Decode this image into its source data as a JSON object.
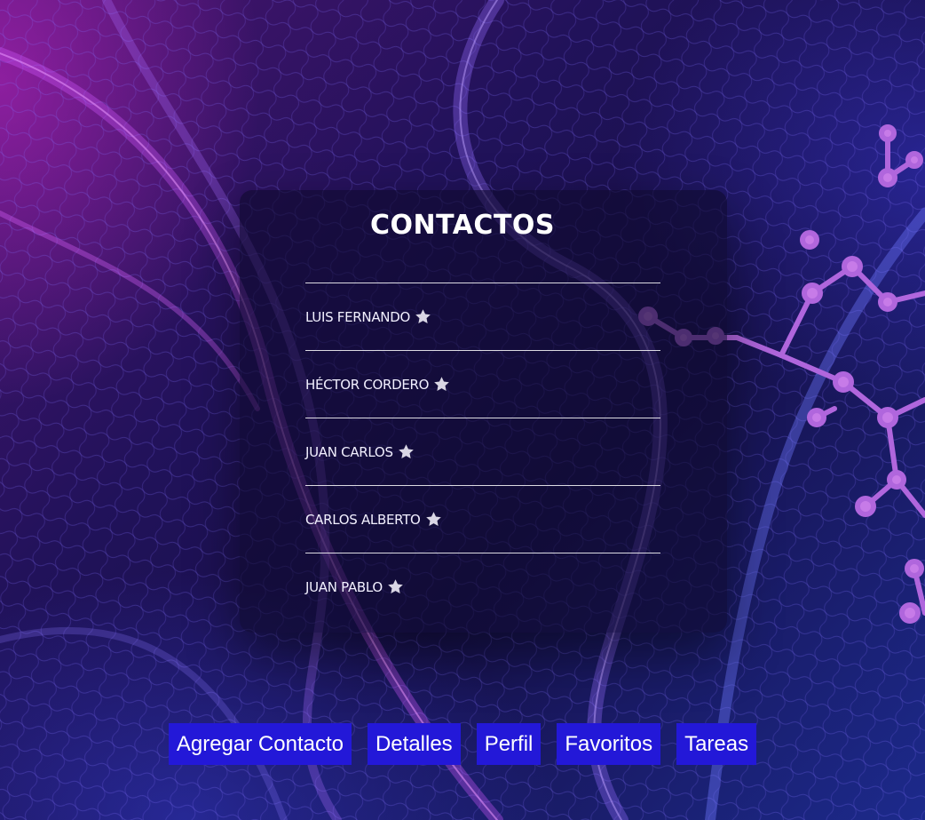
{
  "contacts": {
    "title": "CONTACTOS",
    "items": [
      {
        "name": "LUIS FERNANDO"
      },
      {
        "name": "HÉCTOR CORDERO"
      },
      {
        "name": "JUAN CARLOS"
      },
      {
        "name": "CARLOS ALBERTO"
      },
      {
        "name": "JUAN PABLO"
      }
    ],
    "favorite_icon": "star-icon"
  },
  "nav": {
    "buttons": [
      {
        "label": "Agregar Contacto"
      },
      {
        "label": "Detalles"
      },
      {
        "label": "Perfil"
      },
      {
        "label": "Favoritos"
      },
      {
        "label": "Tareas"
      }
    ]
  },
  "colors": {
    "button_bg": "#2318d8",
    "star": "#d9d6e4",
    "text": "#ffffff"
  }
}
